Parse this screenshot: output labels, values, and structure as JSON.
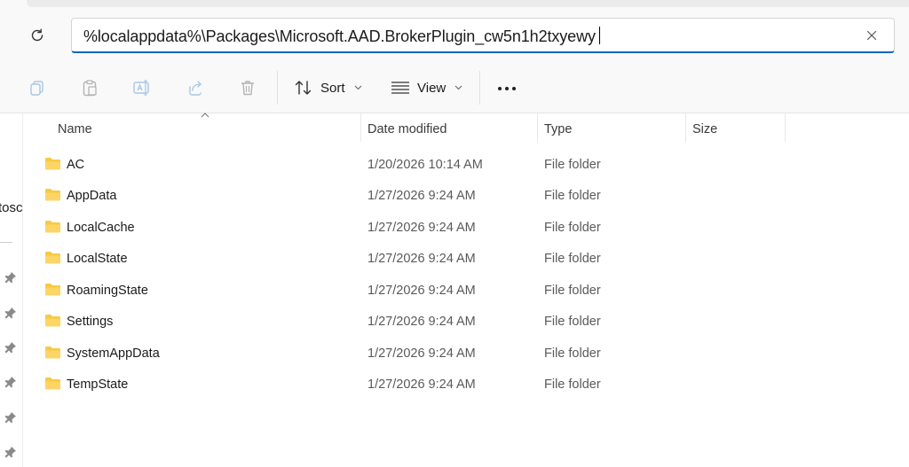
{
  "address_bar": {
    "path": "%localappdata%\\Packages\\Microsoft.AAD.BrokerPlugin_cw5n1h2txyewy"
  },
  "toolbar": {
    "sort_label": "Sort",
    "view_label": "View"
  },
  "left_pane": {
    "partial_label": "tosc"
  },
  "columns": {
    "name": "Name",
    "date": "Date modified",
    "type": "Type",
    "size": "Size"
  },
  "colors": {
    "accent": "#0067c0",
    "folder": "#f8c942"
  },
  "files": [
    {
      "name": "AC",
      "date": "1/20/2026 10:14 AM",
      "type": "File folder"
    },
    {
      "name": "AppData",
      "date": "1/27/2026 9:24 AM",
      "type": "File folder"
    },
    {
      "name": "LocalCache",
      "date": "1/27/2026 9:24 AM",
      "type": "File folder"
    },
    {
      "name": "LocalState",
      "date": "1/27/2026 9:24 AM",
      "type": "File folder"
    },
    {
      "name": "RoamingState",
      "date": "1/27/2026 9:24 AM",
      "type": "File folder"
    },
    {
      "name": "Settings",
      "date": "1/27/2026 9:24 AM",
      "type": "File folder"
    },
    {
      "name": "SystemAppData",
      "date": "1/27/2026 9:24 AM",
      "type": "File folder"
    },
    {
      "name": "TempState",
      "date": "1/27/2026 9:24 AM",
      "type": "File folder"
    }
  ]
}
